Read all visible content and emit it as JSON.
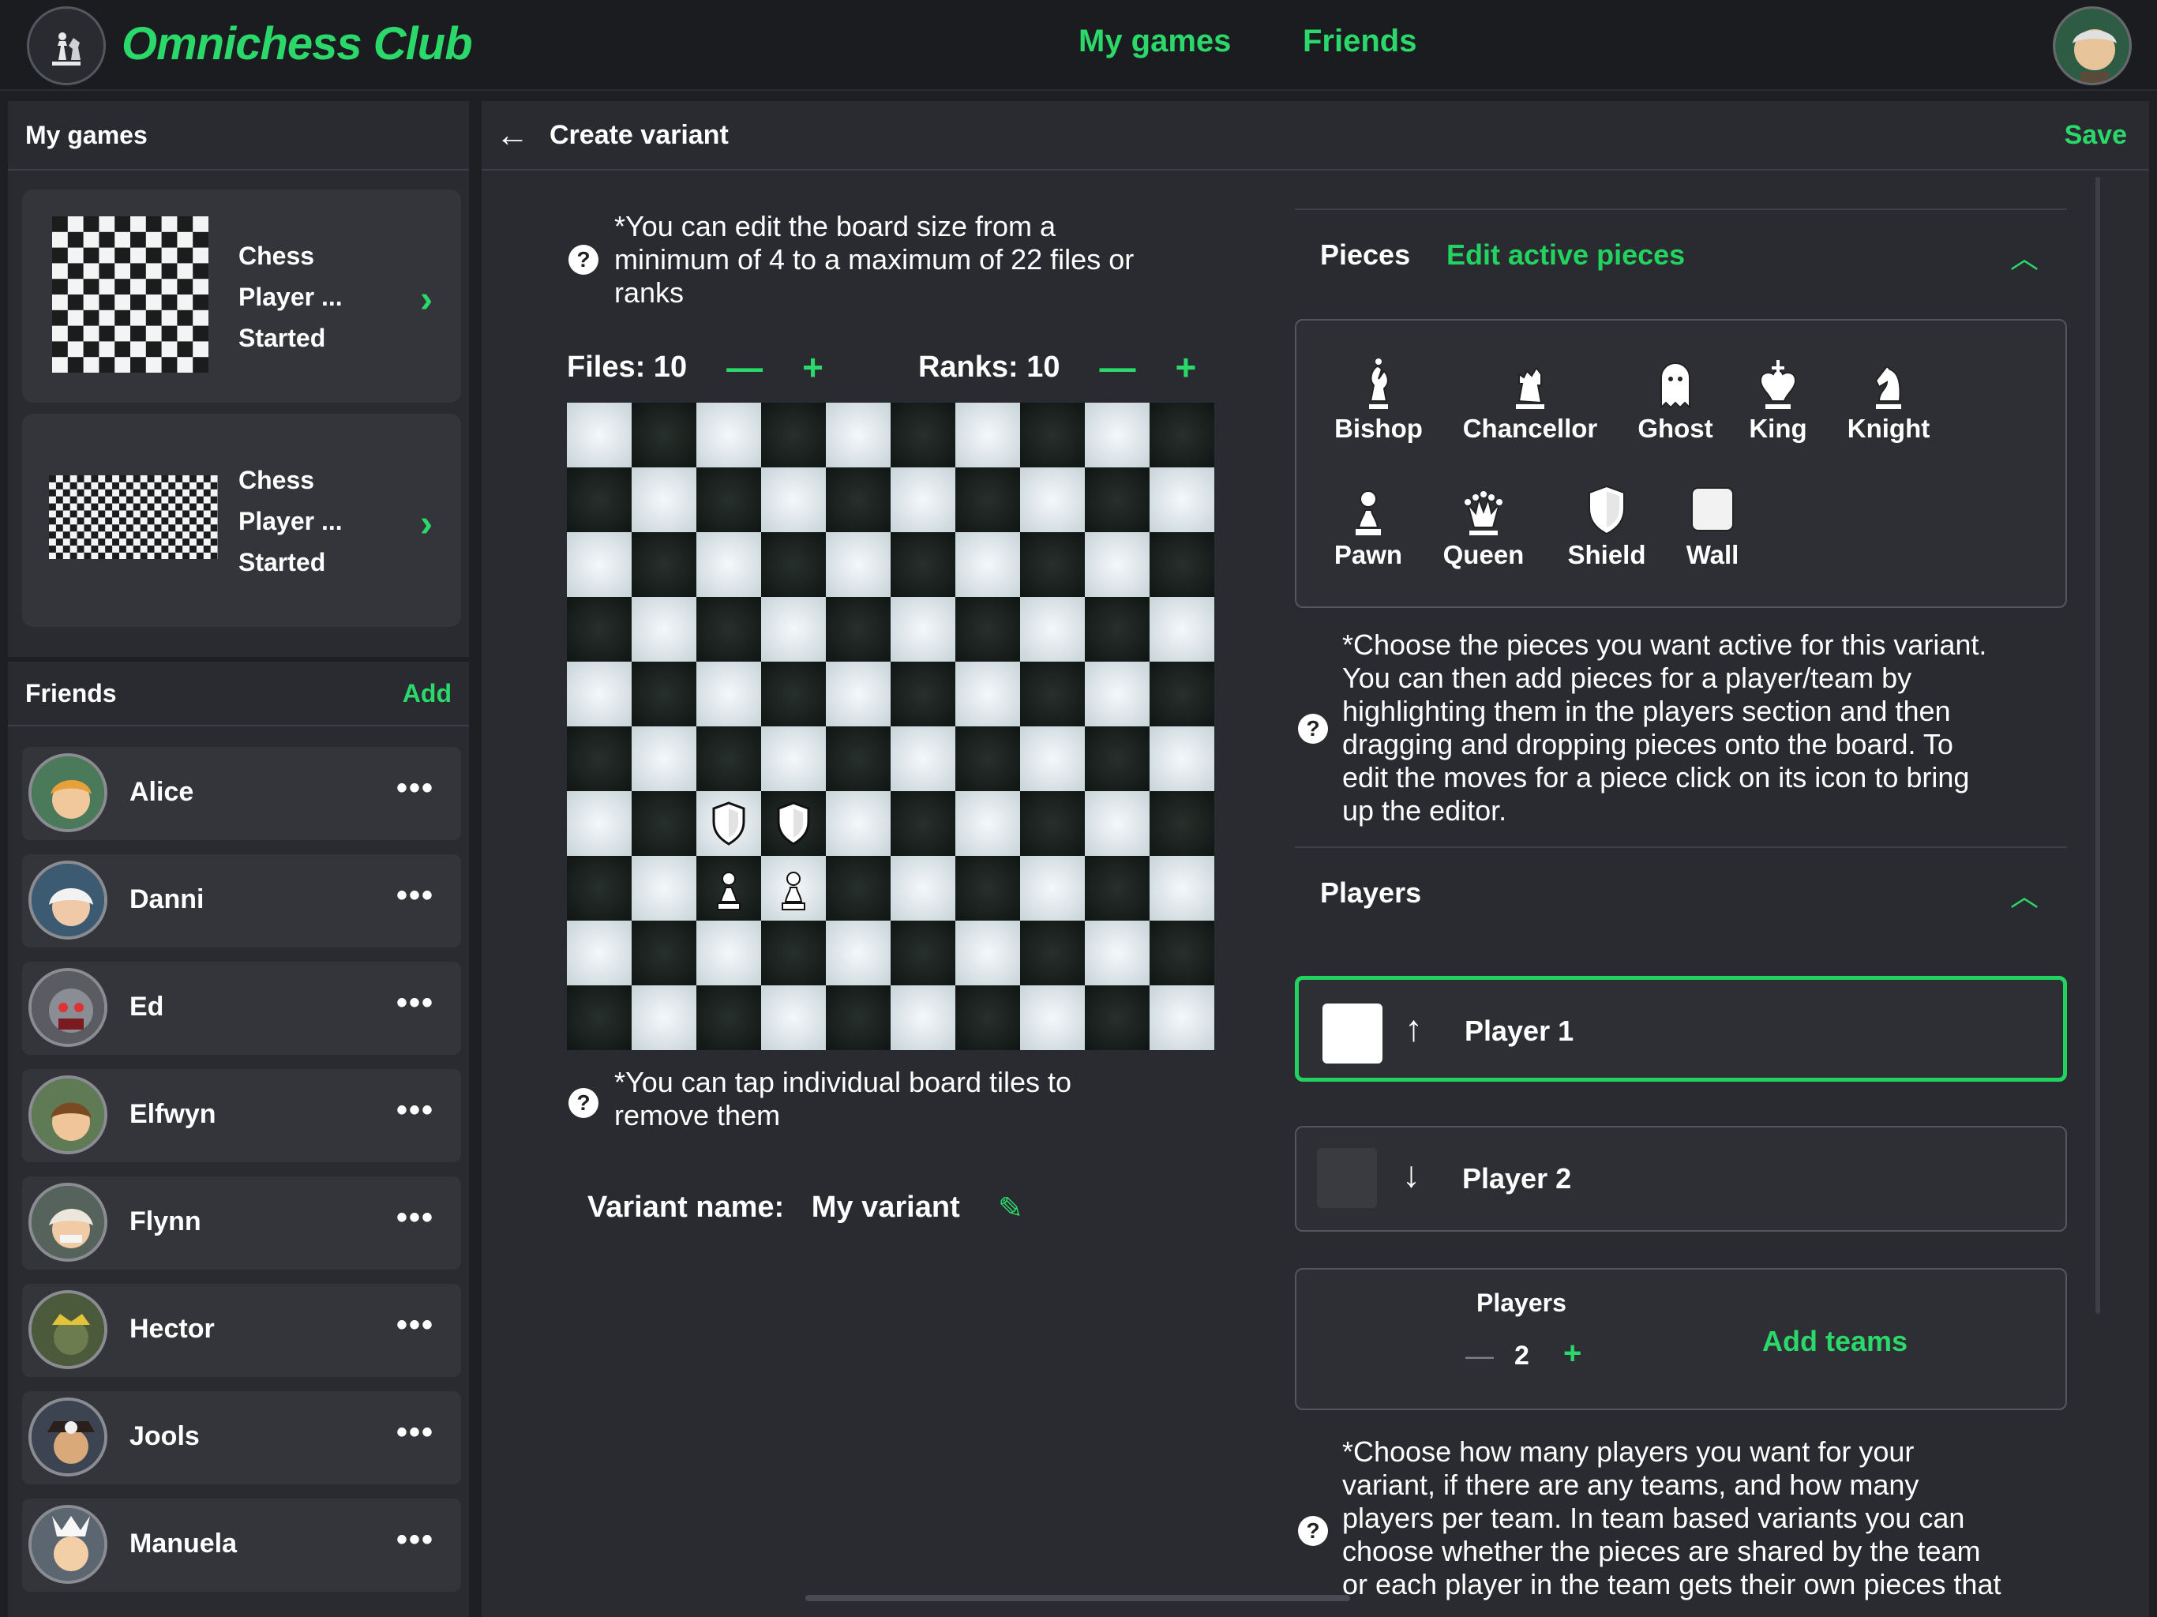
{
  "header": {
    "brand": "Omnichess Club",
    "nav_my_games": "My games",
    "nav_friends": "Friends"
  },
  "sidebar": {
    "my_games_title": "My games",
    "games": [
      {
        "line1": "Chess",
        "line2": "Player ...",
        "line3": "Started"
      },
      {
        "line1": "Chess",
        "line2": "Player ...",
        "line3": "Started"
      }
    ],
    "friends_title": "Friends",
    "add_label": "Add",
    "friends": [
      {
        "name": "Alice"
      },
      {
        "name": "Danni"
      },
      {
        "name": "Ed"
      },
      {
        "name": "Elfwyn"
      },
      {
        "name": "Flynn"
      },
      {
        "name": "Hector"
      },
      {
        "name": "Jools"
      },
      {
        "name": "Manuela"
      }
    ],
    "more_label": "•••"
  },
  "main": {
    "title": "Create variant",
    "save": "Save",
    "board_hint_l1": "*You can edit the board size from a",
    "board_hint_l2": "minimum of 4 to a maximum of 22 files or",
    "board_hint_l3": "ranks",
    "files_label": "Files: 10",
    "ranks_label": "Ranks: 10",
    "files": 10,
    "ranks": 10,
    "minus": "—",
    "plus": "+",
    "tile_hint_l1": "*You can tap individual board tiles to",
    "tile_hint_l2": "remove them",
    "variant_name_label": "Variant name:",
    "variant_name_value": "My variant",
    "help_glyph": "?"
  },
  "pieces_section": {
    "title": "Pieces",
    "edit_link": "Edit active pieces",
    "pieces": [
      "Bishop",
      "Chancellor",
      "Ghost",
      "King",
      "Knight",
      "Pawn",
      "Queen",
      "Shield",
      "Wall"
    ],
    "hint_lines": [
      "*Choose the pieces you want active for this variant.",
      "You can then add pieces for a player/team by",
      "highlighting them in the players section and then",
      "dragging and dropping pieces onto the board. To",
      "edit the moves for a piece click on its icon to bring",
      "up the editor."
    ]
  },
  "players_section": {
    "title": "Players",
    "player1": "Player 1",
    "player2": "Player 2",
    "arrow_up": "↑",
    "arrow_down": "↓",
    "players_label": "Players",
    "players_count": "2",
    "add_teams": "Add teams",
    "hint_lines": [
      "*Choose how many players you want for your",
      "variant, if there are any teams, and how many",
      "players per team. In team based variants you can",
      "choose whether the pieces are shared by the team",
      "or each player in the team gets their own pieces that"
    ]
  },
  "colors": {
    "accent": "#22d35f",
    "player1_color": "#ffffff",
    "player2_color": "#3a3b40"
  }
}
